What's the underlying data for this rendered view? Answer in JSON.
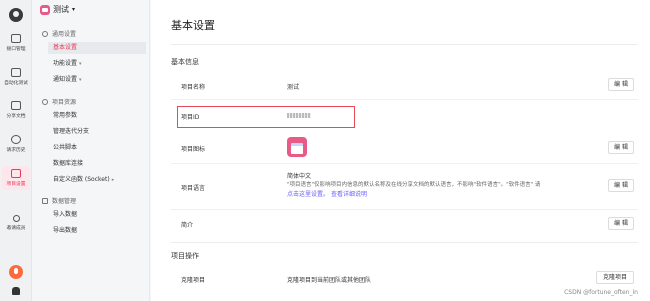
{
  "rail": {
    "items": [
      {
        "label": "接口管理",
        "icon": "api-icon"
      },
      {
        "label": "自动化测试",
        "icon": "automation-icon"
      },
      {
        "label": "分享文档",
        "icon": "doc-icon"
      },
      {
        "label": "请求历史",
        "icon": "history-icon"
      },
      {
        "label": "项目设置",
        "icon": "settings-icon"
      },
      {
        "label": "邀请成员",
        "icon": "invite-icon"
      }
    ],
    "active": "项目设置"
  },
  "sidebar": {
    "project_name": "测试",
    "groups": [
      {
        "label": "通用设置",
        "items": [
          {
            "label": "基本设置",
            "active": true
          },
          {
            "label": "功能设置",
            "arrow": "▾"
          },
          {
            "label": "通知设置",
            "arrow": "▾"
          }
        ]
      },
      {
        "label": "项目资源",
        "items": [
          {
            "label": "常用参数"
          },
          {
            "label": "管理迭代分支"
          },
          {
            "label": "公共脚本"
          },
          {
            "label": "数据库连接"
          },
          {
            "label": "自定义函数 (Socket)",
            "arrow": "▸"
          }
        ]
      },
      {
        "label": "数据管理",
        "items": [
          {
            "label": "导入数据"
          },
          {
            "label": "导出数据"
          }
        ]
      }
    ]
  },
  "main": {
    "title": "基本设置",
    "basic_section": "基本信息",
    "rows": {
      "name_label": "项目名称",
      "name_value": "测试",
      "id_label": "项目ID",
      "icon_label": "项目图标",
      "lang_label": "项目语言",
      "lang_value": "简体中文",
      "lang_desc": "\"项目语言\"仅影响项目内信息的默认名称及在线分享文档的默认语言，不影响\"软件语言\"。\"软件语言\" 请",
      "lang_link1": "点击这里设置。",
      "lang_link2": "查看详细说明",
      "intro_label": "简介"
    },
    "edit_label": "编 辑",
    "ops_section": "项目操作",
    "clone_label": "克隆项目",
    "clone_desc": "克隆项目到当前团队或其他团队",
    "clone_button": "克隆项目"
  },
  "footer": {
    "watermark": "CSDN @fortune_often_in"
  },
  "colors": {
    "accent": "#e23b5b",
    "link": "#6a5cff",
    "highlight_box": "#e34a5a"
  }
}
